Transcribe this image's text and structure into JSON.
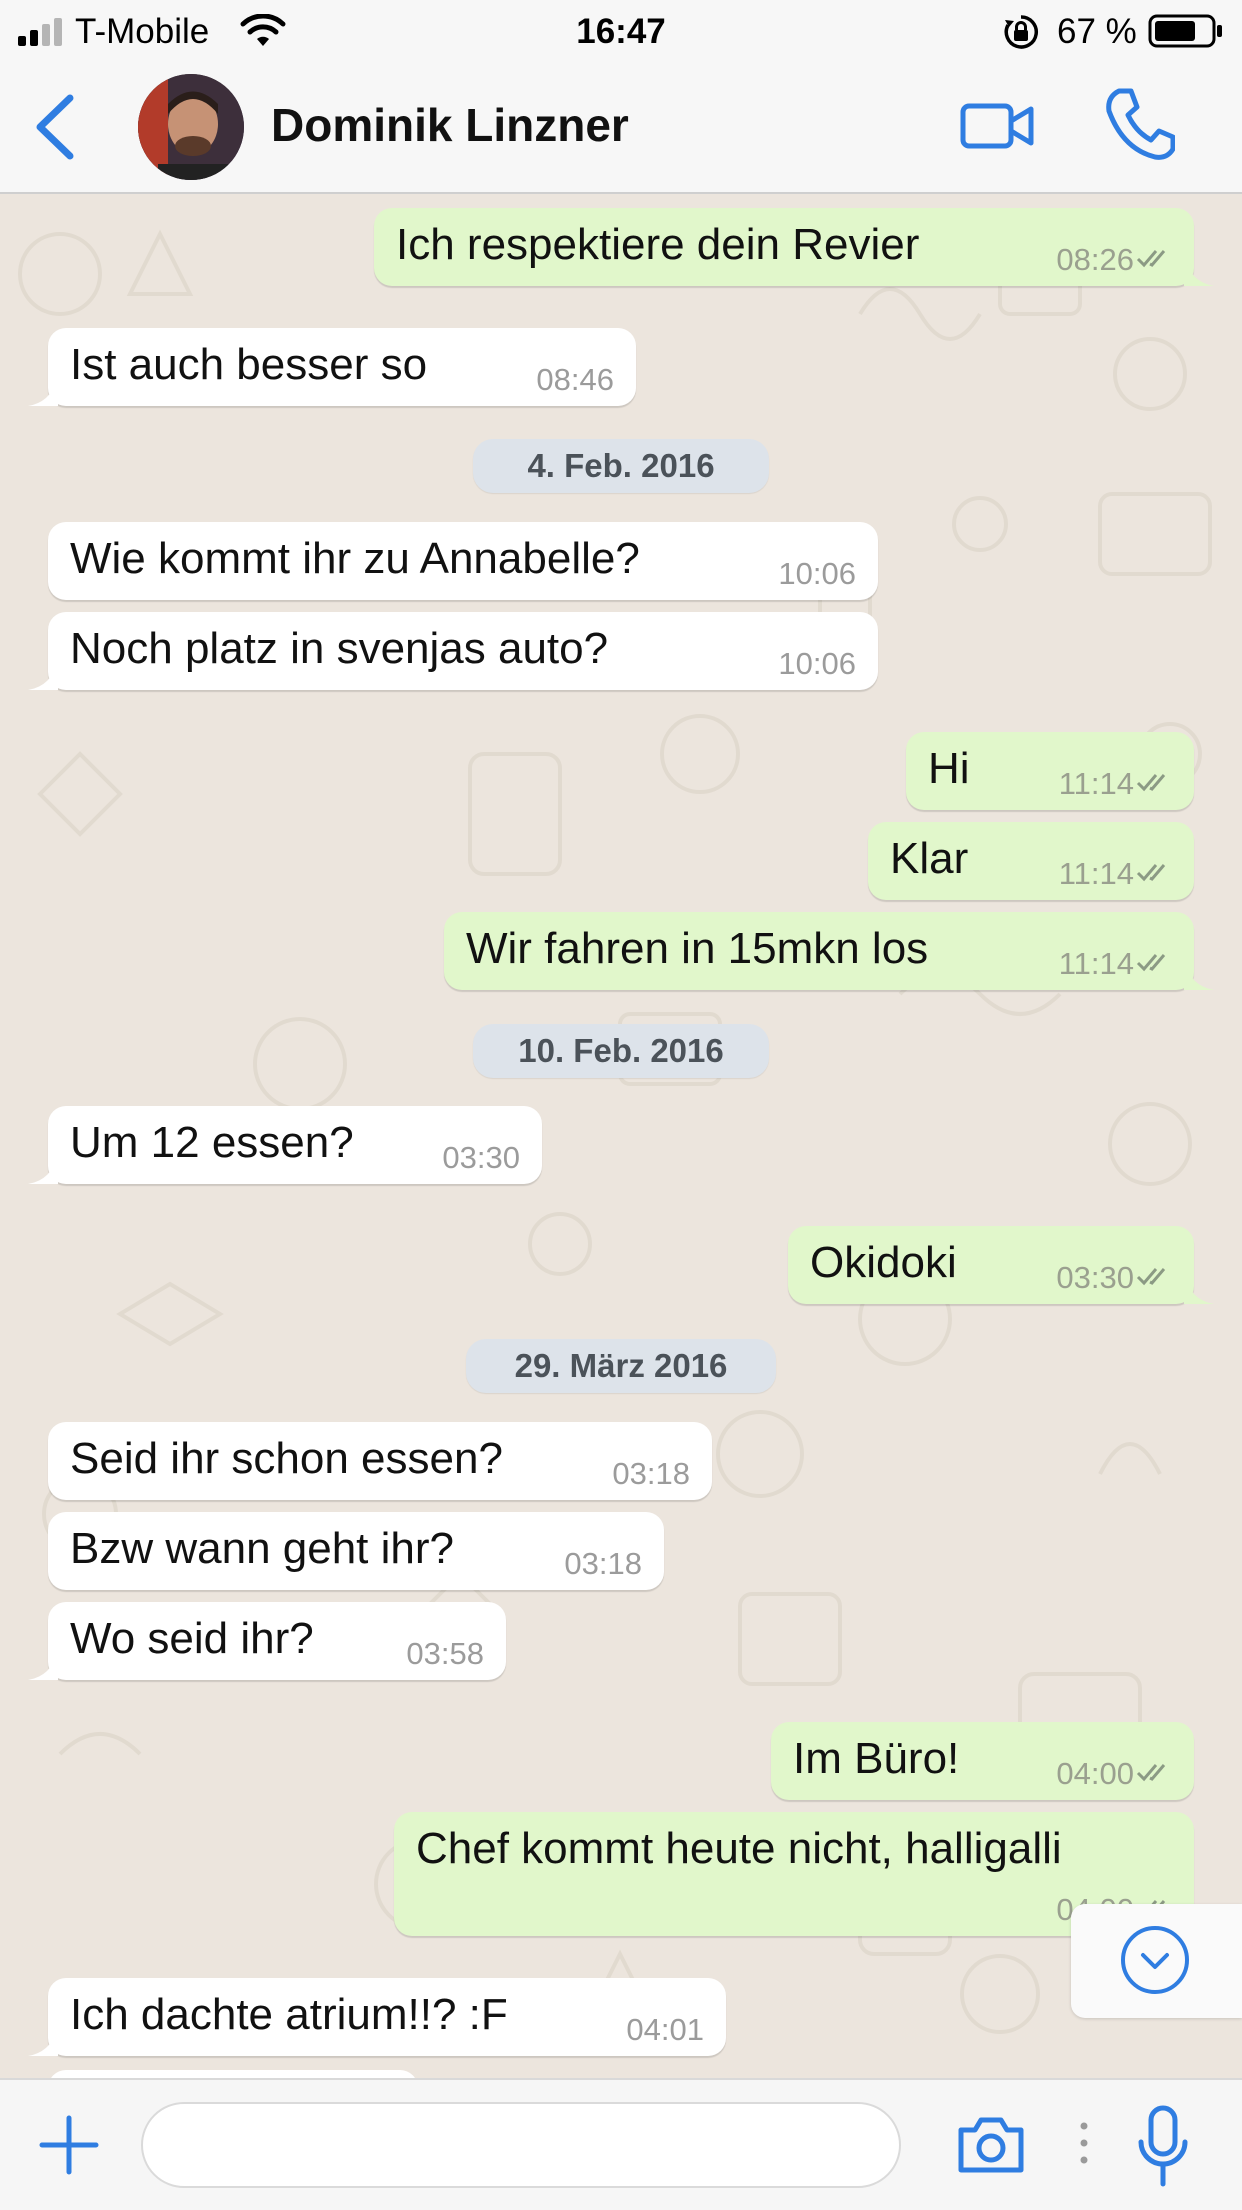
{
  "status_bar": {
    "carrier": "T-Mobile",
    "time": "16:47",
    "battery_percent": "67 %"
  },
  "header": {
    "contact_name": "Dominik Linzner"
  },
  "messages": [
    {
      "direction": "out",
      "text": "Ich respektiere dein Revier",
      "time": "08:26",
      "read": true
    },
    {
      "direction": "in",
      "text": "Ist auch besser so",
      "time": "08:46"
    },
    {
      "type": "date",
      "label": "4. Feb. 2016"
    },
    {
      "direction": "in",
      "text": "Wie kommt ihr zu Annabelle?",
      "time": "10:06"
    },
    {
      "direction": "in",
      "text": "Noch platz in svenjas auto?",
      "time": "10:06"
    },
    {
      "direction": "out",
      "text": "Hi",
      "time": "11:14",
      "read": true
    },
    {
      "direction": "out",
      "text": "Klar",
      "time": "11:14",
      "read": true
    },
    {
      "direction": "out",
      "text": "Wir fahren in 15mkn los",
      "time": "11:14",
      "read": true
    },
    {
      "type": "date",
      "label": "10. Feb. 2016"
    },
    {
      "direction": "in",
      "text": "Um 12 essen?",
      "time": "03:30"
    },
    {
      "direction": "out",
      "text": "Okidoki",
      "time": "03:30",
      "read": true
    },
    {
      "type": "date",
      "label": "29. März 2016"
    },
    {
      "direction": "in",
      "text": "Seid ihr schon essen?",
      "time": "03:18"
    },
    {
      "direction": "in",
      "text": "Bzw wann geht ihr?",
      "time": "03:18"
    },
    {
      "direction": "in",
      "text": "Wo seid ihr?",
      "time": "03:58"
    },
    {
      "direction": "out",
      "text": "Im Büro!",
      "time": "04:00",
      "read": true
    },
    {
      "direction": "out",
      "text": "Chef kommt heute nicht, halligalli",
      "time": "04:00",
      "read": true
    },
    {
      "direction": "in",
      "text": "Ich dachte atrium!!? :F",
      "time": "04:01"
    }
  ],
  "input": {
    "value": "",
    "placeholder": ""
  },
  "icons": {
    "back": "chevron-left-icon",
    "video": "video-camera-icon",
    "call": "phone-icon",
    "scroll": "chevron-down-circle-icon",
    "attach": "plus-icon",
    "camera": "camera-icon",
    "mic": "microphone-icon"
  },
  "colors": {
    "accent": "#2f7de1",
    "outgoing_bubble": "#e1f7cb",
    "incoming_bubble": "#ffffff",
    "chat_background": "#ece5dd",
    "date_chip": "#dde3ea",
    "read_ticks": "#8b9a84"
  }
}
